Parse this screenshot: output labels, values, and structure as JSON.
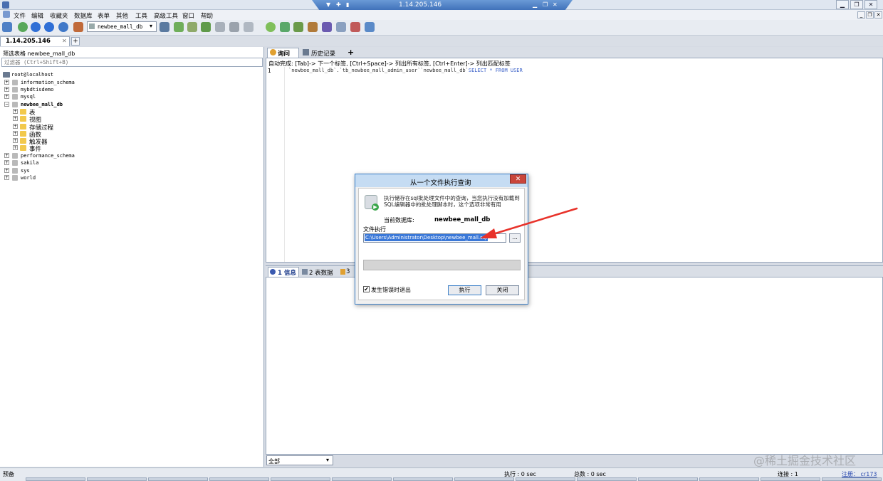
{
  "window": {
    "title": "1.14.205.146",
    "controls": {
      "minimize": "▁",
      "restore": "❐",
      "close": "✕"
    },
    "mdi_controls": {
      "minimize": "_",
      "restore": "❐",
      "close": "✕"
    }
  },
  "menu": [
    "文件",
    "编辑",
    "收藏夹",
    "数据库",
    "表单",
    "其他",
    "工具",
    "高级工具",
    "窗口",
    "帮助"
  ],
  "toolbar": {
    "db_select_value": "newbee_mall_db",
    "icons": [
      "new-connection-icon",
      "refresh-icon",
      "back-icon",
      "forward-icon",
      "help-icon",
      "users-icon",
      "backup-icon",
      "import-icon",
      "export-icon",
      "schema-icon",
      "query-builder-icon",
      "sync-icon",
      "copy-icon",
      "tools-icon",
      "report-icon",
      "grid-icon"
    ]
  },
  "connection_tab": {
    "label": "1.14.205.146",
    "close": "✕",
    "add": "+"
  },
  "left_panel": {
    "filter_label": "筛选表格 newbee_mall_db",
    "filter_placeholder": "过滤器 (Ctrl+Shift+B)",
    "root": "root@localhost",
    "databases": [
      "information_schema",
      "mybdtisdemo",
      "mysql",
      "newbee_mall_db",
      "performance_schema",
      "sakila",
      "sys",
      "world"
    ],
    "expanded_db": "newbee_mall_db",
    "folders": [
      "表",
      "视图",
      "存储过程",
      "函数",
      "触发器",
      "事件"
    ]
  },
  "editor": {
    "tabs": [
      "询问",
      "历史记录"
    ],
    "add_tab": "+",
    "autocomplete_hint": "自动完成: [Tab]-> 下一个标签, [Ctrl+Space]-> 列出所有标签, [Ctrl+Enter]-> 列出匹配标签",
    "line_number": "1",
    "sql_text": "`newbee_mall_db`.`tb_newbee_mall_admin_user``newbee_mall_db`",
    "sql_keywords": "SELECT * FROM   USER"
  },
  "results": {
    "tabs": [
      "1 信息",
      "2 表数据",
      "3"
    ],
    "filter_value": "全部"
  },
  "status_bar": {
    "left": "预备",
    "exec_time": "执行 : 0 sec",
    "total_time": "总数 : 0 sec",
    "connections": "连接 : 1",
    "register": "注册： cr173"
  },
  "dialog": {
    "title": "从一个文件执行查询",
    "close": "✕",
    "description": "执行储存在sql批处理文件中的查询，当您执行没有加载到SQL编辑器中的批处理脚本时，这个选项非常有用",
    "current_db_label": "当前数据库:",
    "current_db_value": "newbee_mall_db",
    "file_label": "文件执行",
    "file_path": "C:\\Users\\Administrator\\Desktop\\newbee_mall.sql",
    "browse": "...",
    "exit_on_error_label": "发生错误时退出",
    "exit_on_error_checked": "✔",
    "execute_button": "执行",
    "close_button": "关闭"
  },
  "annotation": {
    "arrow_color": "#e8322a"
  },
  "watermark": "@稀土掘金技术社区"
}
